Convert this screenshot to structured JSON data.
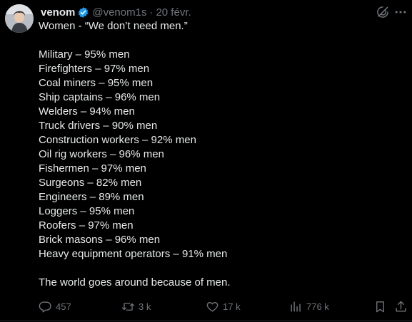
{
  "author": {
    "name": "venom",
    "handle": "@venom1s",
    "separator": "·",
    "date": "20 févr.",
    "verified": true,
    "verified_color": "#1d9bf0"
  },
  "tweet": {
    "intro": "Women - “We don’t need men.”",
    "list": [
      "Military – 95% men",
      "Firefighters – 97% men",
      "Coal miners – 95% men",
      "Ship captains – 96% men",
      "Welders – 94% men",
      "Truck drivers – 90% men",
      "Construction workers – 92% men",
      "Oil rig workers – 96% men",
      "Fishermen – 97% men",
      "Surgeons – 82% men",
      "Engineers – 89% men",
      "Loggers – 95% men",
      "Roofers – 97% men",
      "Brick masons – 96% men",
      "Heavy equipment operators – 91% men"
    ],
    "closing": "The world goes around because of men."
  },
  "actions": {
    "replies": "457",
    "reposts": "3 k",
    "likes": "17 k",
    "views": "776 k"
  },
  "icons": {
    "grok": "grok-icon",
    "more": "more-icon",
    "reply": "reply-icon",
    "repost": "repost-icon",
    "like": "like-icon",
    "views": "views-icon",
    "bookmark": "bookmark-icon",
    "share": "share-icon"
  },
  "colors": {
    "background": "#000000",
    "text": "#e7e9ea",
    "muted": "#71767b",
    "accent": "#1d9bf0"
  }
}
